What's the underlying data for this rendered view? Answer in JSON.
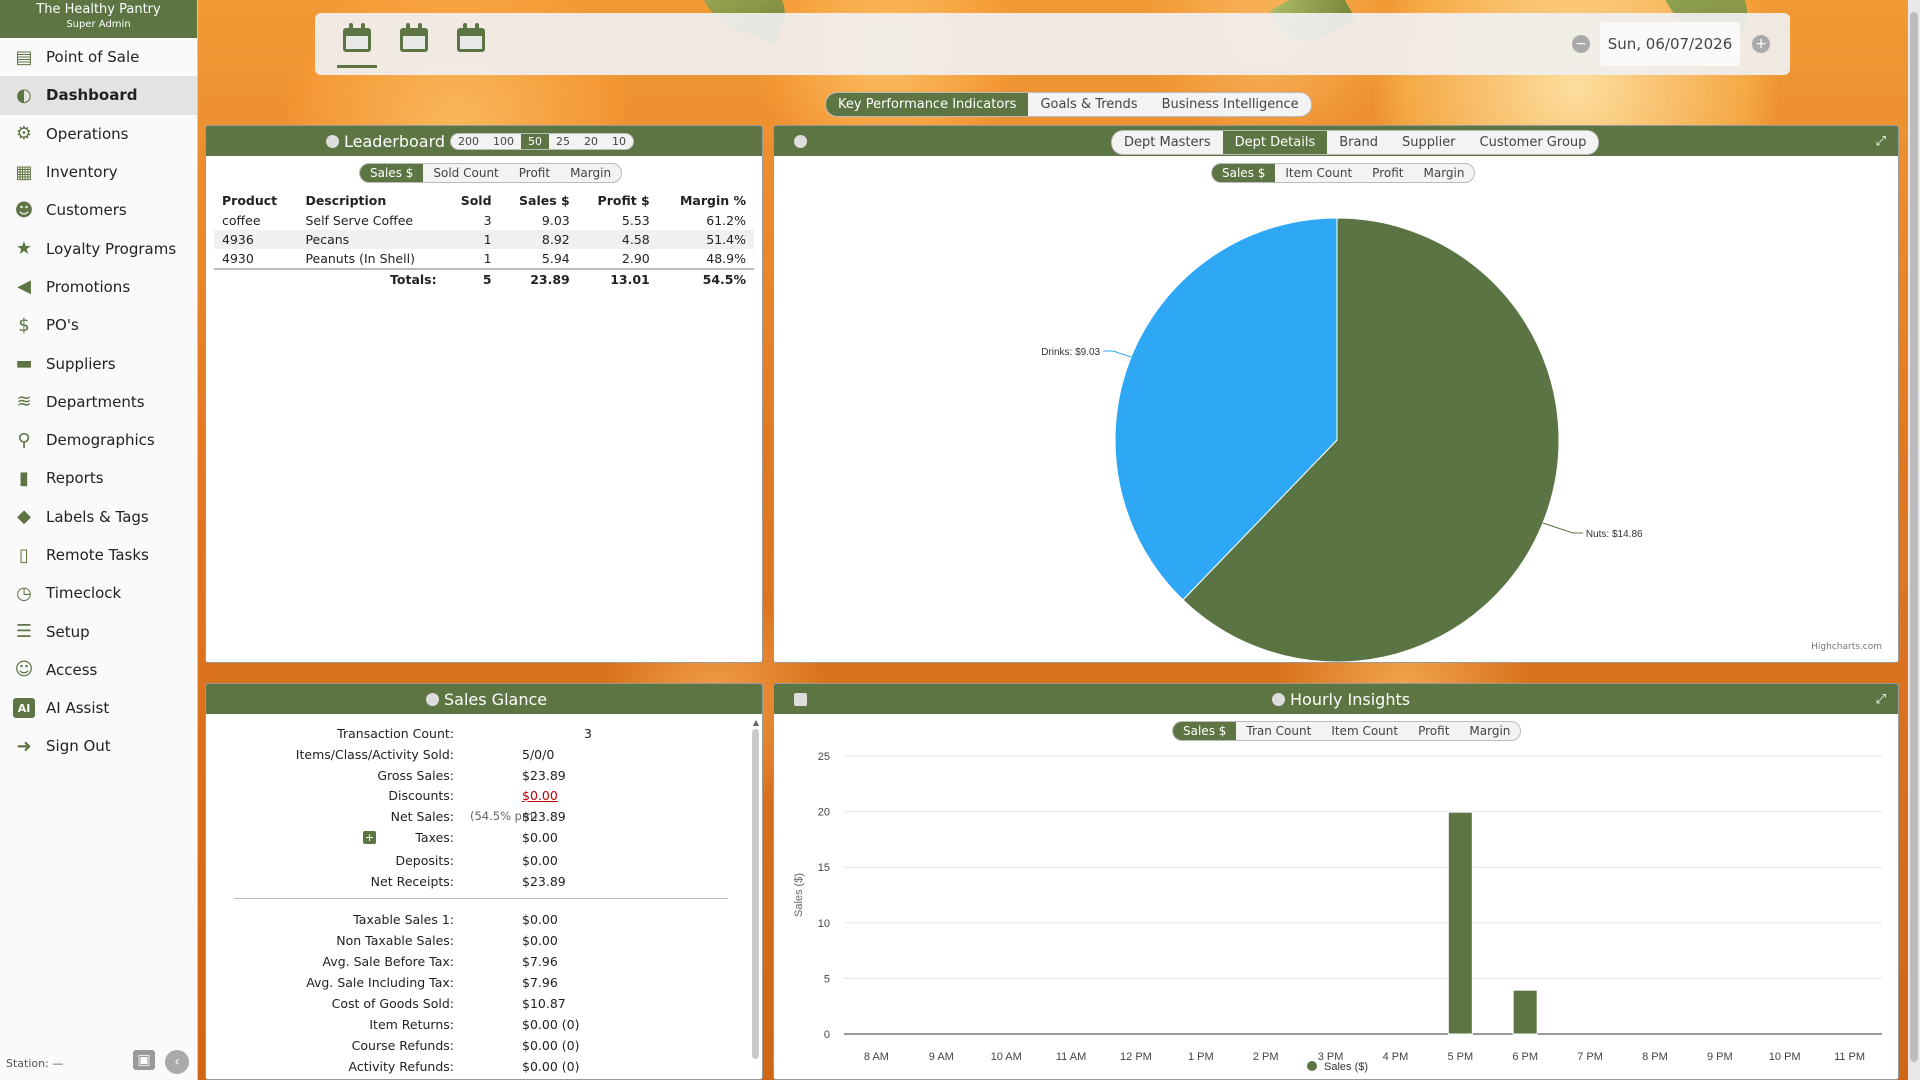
{
  "app": {
    "store_name": "The Healthy Pantry",
    "user_role": "Super Admin",
    "station": "Station: —"
  },
  "sidebar": {
    "items": [
      {
        "label": "Point of Sale",
        "icon": "register-icon"
      },
      {
        "label": "Dashboard",
        "icon": "gauge-icon",
        "active": true
      },
      {
        "label": "Operations",
        "icon": "operations-icon"
      },
      {
        "label": "Inventory",
        "icon": "inventory-icon"
      },
      {
        "label": "Customers",
        "icon": "customers-icon"
      },
      {
        "label": "Loyalty Programs",
        "icon": "loyalty-icon"
      },
      {
        "label": "Promotions",
        "icon": "megaphone-icon"
      },
      {
        "label": "PO's",
        "icon": "purchase-order-icon"
      },
      {
        "label": "Suppliers",
        "icon": "truck-icon"
      },
      {
        "label": "Departments",
        "icon": "layers-icon"
      },
      {
        "label": "Demographics",
        "icon": "map-pin-icon"
      },
      {
        "label": "Reports",
        "icon": "bar-chart-icon"
      },
      {
        "label": "Labels & Tags",
        "icon": "tag-icon"
      },
      {
        "label": "Remote Tasks",
        "icon": "tablet-icon"
      },
      {
        "label": "Timeclock",
        "icon": "clock-icon"
      },
      {
        "label": "Setup",
        "icon": "sliders-icon"
      },
      {
        "label": "Access",
        "icon": "user-lock-icon"
      },
      {
        "label": "AI Assist",
        "icon": "ai-icon"
      },
      {
        "label": "Sign Out",
        "icon": "sign-out-icon"
      }
    ]
  },
  "topbar": {
    "date": "Sun, 06/07/2026"
  },
  "kpi_tabs": {
    "tabs": [
      "Key Performance Indicators",
      "Goals & Trends",
      "Business Intelligence"
    ],
    "active": 0
  },
  "leaderboard": {
    "title": "Leaderboard",
    "limits": [
      "200",
      "100",
      "50",
      "25",
      "20",
      "10"
    ],
    "active_limit": "50",
    "metrics": [
      "Sales $",
      "Sold Count",
      "Profit",
      "Margin"
    ],
    "active_metric": 0,
    "headers": [
      "Product",
      "Description",
      "Sold",
      "Sales $",
      "Profit $",
      "Margin %"
    ],
    "rows": [
      [
        "coffee",
        "Self Serve Coffee",
        "3",
        "9.03",
        "5.53",
        "61.2%"
      ],
      [
        "4936",
        "Pecans",
        "1",
        "8.92",
        "4.58",
        "51.4%"
      ],
      [
        "4930",
        "Peanuts (In Shell)",
        "1",
        "5.94",
        "2.90",
        "48.9%"
      ]
    ],
    "totals": {
      "label": "Totals:",
      "sold": "5",
      "sales": "23.89",
      "profit": "13.01",
      "margin": "54.5%"
    }
  },
  "dept_panel": {
    "tabs": [
      "Dept Masters",
      "Dept Details",
      "Brand",
      "Supplier",
      "Customer Group"
    ],
    "active_tab": 1,
    "metrics": [
      "Sales $",
      "Item Count",
      "Profit",
      "Margin"
    ],
    "active_metric": 0,
    "credit": "Highcharts.com"
  },
  "sales_glance": {
    "title": "Sales Glance",
    "rows": [
      {
        "label": "Transaction Count:",
        "value": "3"
      },
      {
        "label": "Items/Class/Activity Sold:",
        "value": "5/0/0"
      },
      {
        "label": "Gross Sales:",
        "value": "$23.89"
      },
      {
        "label": "Discounts:",
        "value": "$0.00",
        "link": true
      },
      {
        "label": "Net Sales:",
        "value": "$23.89",
        "note": "(54.5% pm)"
      },
      {
        "label": "Taxes:",
        "value": "$0.00",
        "expand": true
      },
      {
        "label": "Deposits:",
        "value": "$0.00"
      },
      {
        "label": "Net Receipts:",
        "value": "$23.89"
      }
    ],
    "rows2": [
      {
        "label": "Taxable Sales 1:",
        "value": "$0.00"
      },
      {
        "label": "Non Taxable Sales:",
        "value": "$0.00"
      },
      {
        "label": "Avg. Sale Before Tax:",
        "value": "$7.96"
      },
      {
        "label": "Avg. Sale Including Tax:",
        "value": "$7.96"
      },
      {
        "label": "Cost of Goods Sold:",
        "value": "$10.87"
      },
      {
        "label": "Item Returns:",
        "value": "$0.00 (0)"
      },
      {
        "label": "Course Refunds:",
        "value": "$0.00 (0)"
      },
      {
        "label": "Activity Refunds:",
        "value": "$0.00 (0)"
      }
    ]
  },
  "hourly": {
    "title": "Hourly Insights",
    "metrics": [
      "Sales $",
      "Tran Count",
      "Item Count",
      "Profit",
      "Margin"
    ],
    "active_metric": 0
  },
  "colors": {
    "brand_green": "#5d7443",
    "pie_blue": "#2ea8f5",
    "pie_green": "#5a7444",
    "discount_red": "#c00000"
  },
  "chart_data": [
    {
      "type": "pie",
      "slices": [
        {
          "name": "Nuts",
          "value": 14.86,
          "label": "Nuts: $14.86"
        },
        {
          "name": "Drinks",
          "value": 9.03,
          "label": "Drinks: $9.03"
        }
      ]
    },
    {
      "type": "bar",
      "categories": [
        "8 AM",
        "9 AM",
        "10 AM",
        "11 AM",
        "12 PM",
        "1 PM",
        "2 PM",
        "3 PM",
        "4 PM",
        "5 PM",
        "6 PM",
        "7 PM",
        "8 PM",
        "9 PM",
        "10 PM",
        "11 PM"
      ],
      "series": [
        {
          "name": "Sales ($)",
          "values": [
            0,
            0,
            0,
            0,
            0,
            0,
            0,
            0,
            0,
            19.95,
            3.94,
            0,
            0,
            0,
            0,
            0
          ]
        }
      ],
      "ylabel": "Sales ($)",
      "yticks": [
        "0",
        "5",
        "10",
        "15",
        "20",
        "25"
      ],
      "ylim": [
        0,
        25
      ],
      "legend": "bottom-center"
    }
  ]
}
